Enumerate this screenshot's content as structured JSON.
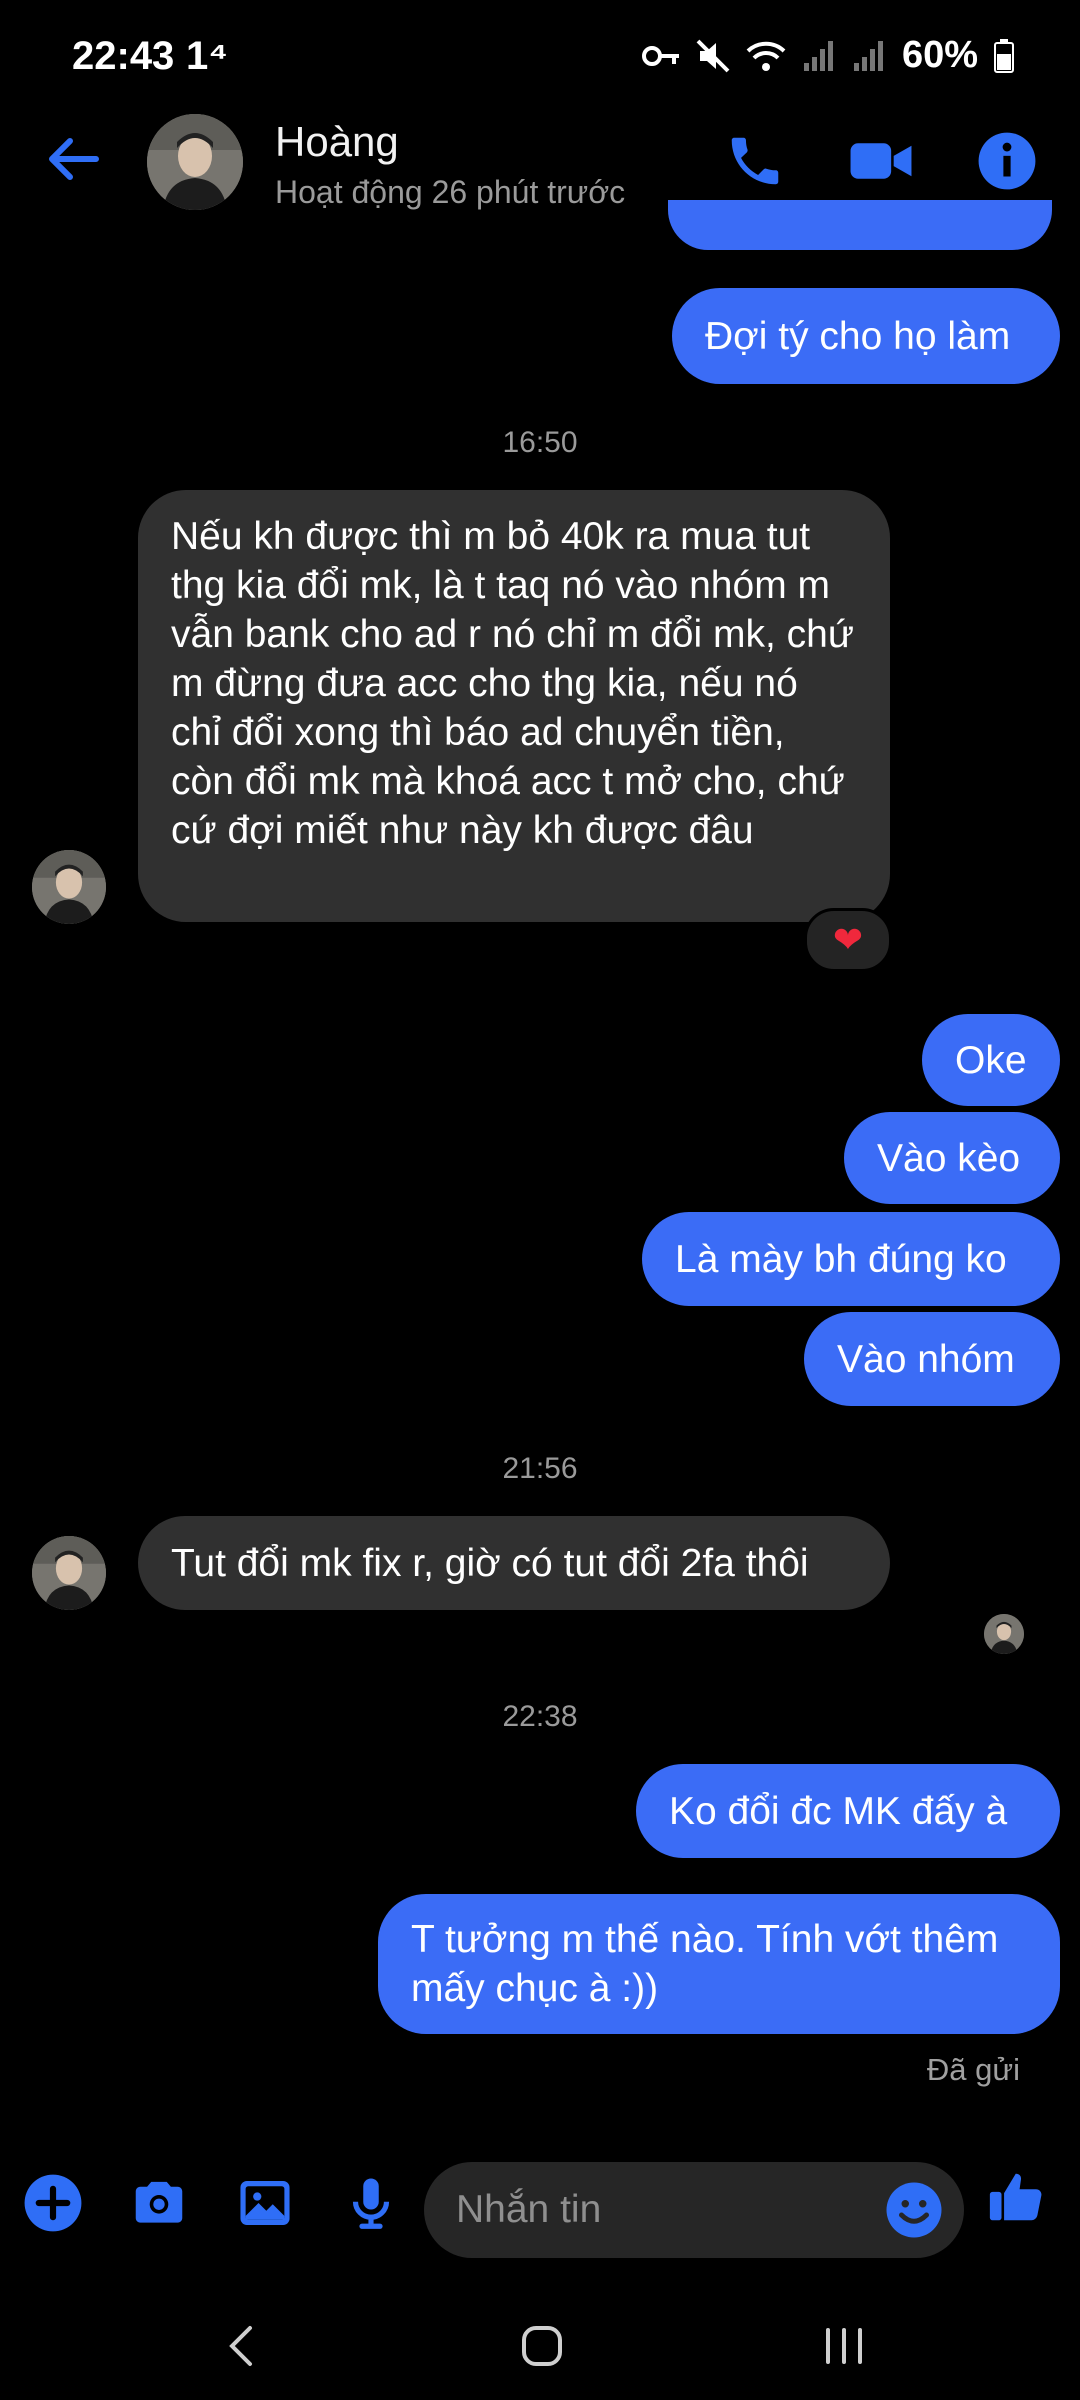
{
  "status_bar": {
    "time": "22:43",
    "carrier_icon": "1⁴",
    "battery": "60%"
  },
  "header": {
    "contact_name": "Hoàng",
    "contact_status": "Hoạt động 26 phút trước"
  },
  "messages": [
    {
      "id": "m0",
      "direction": "out",
      "text": "Đợi tý cho họ làm"
    },
    {
      "id": "ts1",
      "type": "timestamp",
      "text": "16:50"
    },
    {
      "id": "m1",
      "direction": "in",
      "text": "Nếu kh được thì m bỏ 40k ra mua tut thg kia đổi mk, là t taq nó vào nhóm m vẫn bank cho ad r nó chỉ m đổi mk, chứ m đừng đưa acc cho thg kia, nếu nó chỉ đổi xong thì báo ad chuyển tiền, còn đổi mk mà khoá acc t mở cho, chứ cứ đợi miết như này kh được đâu",
      "reaction": "❤"
    },
    {
      "id": "m2",
      "direction": "out",
      "text": "Oke"
    },
    {
      "id": "m3",
      "direction": "out",
      "text": "Vào kèo"
    },
    {
      "id": "m4",
      "direction": "out",
      "text": "Là mày bh đúng ko"
    },
    {
      "id": "m5",
      "direction": "out",
      "text": "Vào nhóm"
    },
    {
      "id": "ts2",
      "type": "timestamp",
      "text": "21:56"
    },
    {
      "id": "m6",
      "direction": "in",
      "text": "Tut đổi mk fix r, giờ có tut đổi 2fa thôi"
    },
    {
      "id": "ts3",
      "type": "timestamp",
      "text": "22:38"
    },
    {
      "id": "m7",
      "direction": "out",
      "text": "Ko đổi đc MK đấy à"
    },
    {
      "id": "m8",
      "direction": "out",
      "text": "T tưởng m thế nào. Tính vớt thêm mấy chục à :))"
    }
  ],
  "delivery_status": "Đã gửi",
  "composer": {
    "placeholder": "Nhắn tin"
  },
  "colors": {
    "accent": "#3b6cf6",
    "incoming_bubble": "#303030",
    "background": "#000000",
    "icon_blue": "#2f6ef6"
  }
}
